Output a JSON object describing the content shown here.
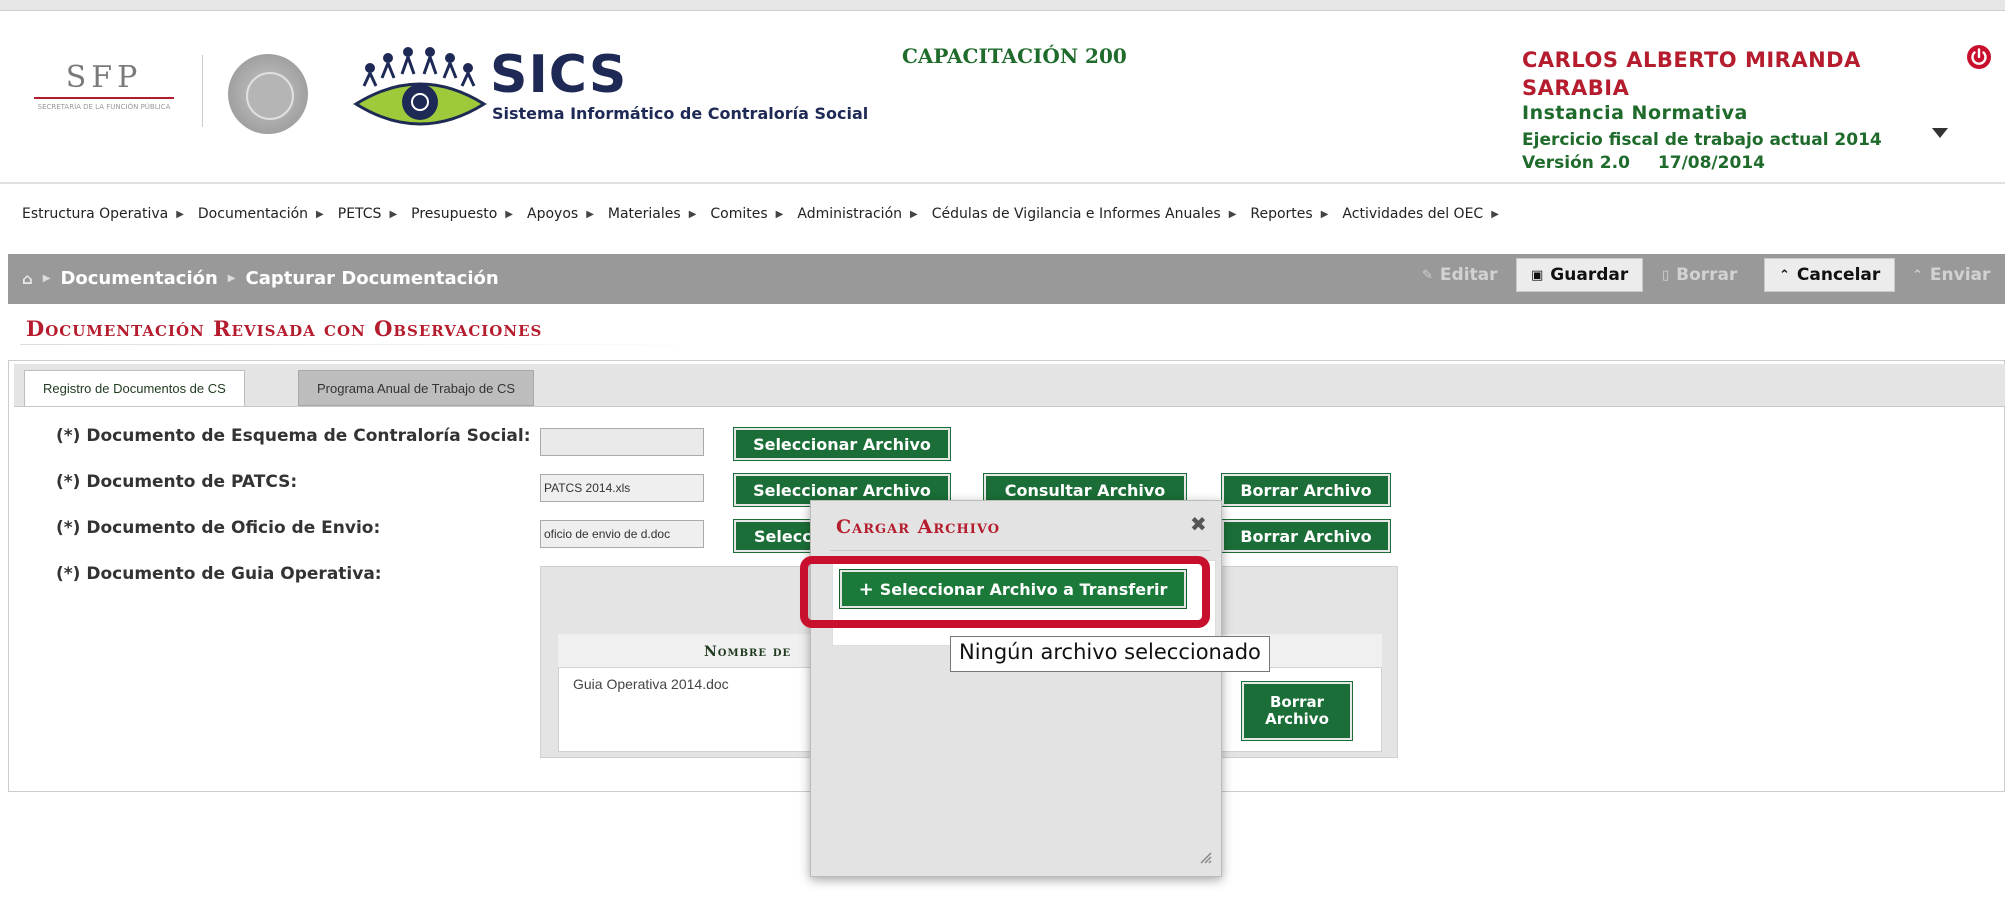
{
  "header": {
    "sfp_logo": "SFP",
    "sfp_subtext": "SECRETARÍA DE LA FUNCIÓN PÚBLICA",
    "app_name": "SICS",
    "app_subtitle": "Sistema Informático de Contraloría Social",
    "environment": "CAPACITACIÓN 200",
    "user": {
      "name": "CARLOS ALBERTO MIRANDA SARABIA",
      "instance": "Instancia Normativa",
      "fiscal_year": "Ejercicio fiscal de trabajo actual 2014",
      "version": "Versión 2.0",
      "date": "17/08/2014"
    },
    "icons": {
      "power": "power-icon",
      "dropdown": "chevron-down-icon"
    },
    "colors": {
      "brand_red": "#b51c2e",
      "brand_green": "#1f6b2c",
      "navy": "#1e2a55"
    }
  },
  "menu": [
    "Estructura Operativa",
    "Documentación",
    "PETCS",
    "Presupuesto",
    "Apoyos",
    "Materiales",
    "Comites",
    "Administración",
    "Cédulas de Vigilancia e Informes Anuales",
    "Reportes",
    "Actividades del OEC"
  ],
  "breadcrumb": {
    "level1": "Documentación",
    "level2": "Capturar Documentación"
  },
  "toolbar": {
    "editar": "Editar",
    "guardar": "Guardar",
    "borrar": "Borrar",
    "cancelar": "Cancelar",
    "enviar": "Enviar"
  },
  "page_title": "Documentación Revisada con Observaciones",
  "tabs": [
    {
      "label": "Registro de Documentos de CS",
      "active": true
    },
    {
      "label": "Programa Anual de Trabajo de CS",
      "active": false
    }
  ],
  "form": {
    "esquema_label": "(*) Documento de Esquema de Contraloría Social:",
    "esquema_value": "",
    "patcs_label": "(*) Documento de PATCS:",
    "patcs_value": "PATCS 2014.xls",
    "oficio_label": "(*) Documento de Oficio de Envio:",
    "oficio_value": "oficio de envio de d.doc",
    "guia_label": "(*) Documento de Guia Operativa:",
    "seleccionar": "Seleccionar Archivo",
    "seleccionar_partial": "Selecci",
    "consultar": "Consultar Archivo",
    "borrar": "Borrar Archivo",
    "guia_table": {
      "header": "Nombre de",
      "row": "Guia Operativa 2014.doc",
      "borrar_line1": "Borrar",
      "borrar_line2": "Archivo"
    }
  },
  "modal": {
    "title": "Cargar Archivo",
    "upload_button": "Seleccionar Archivo a Transferir",
    "tooltip": "Ningún archivo seleccionado",
    "highlight_color": "#c8102e"
  }
}
